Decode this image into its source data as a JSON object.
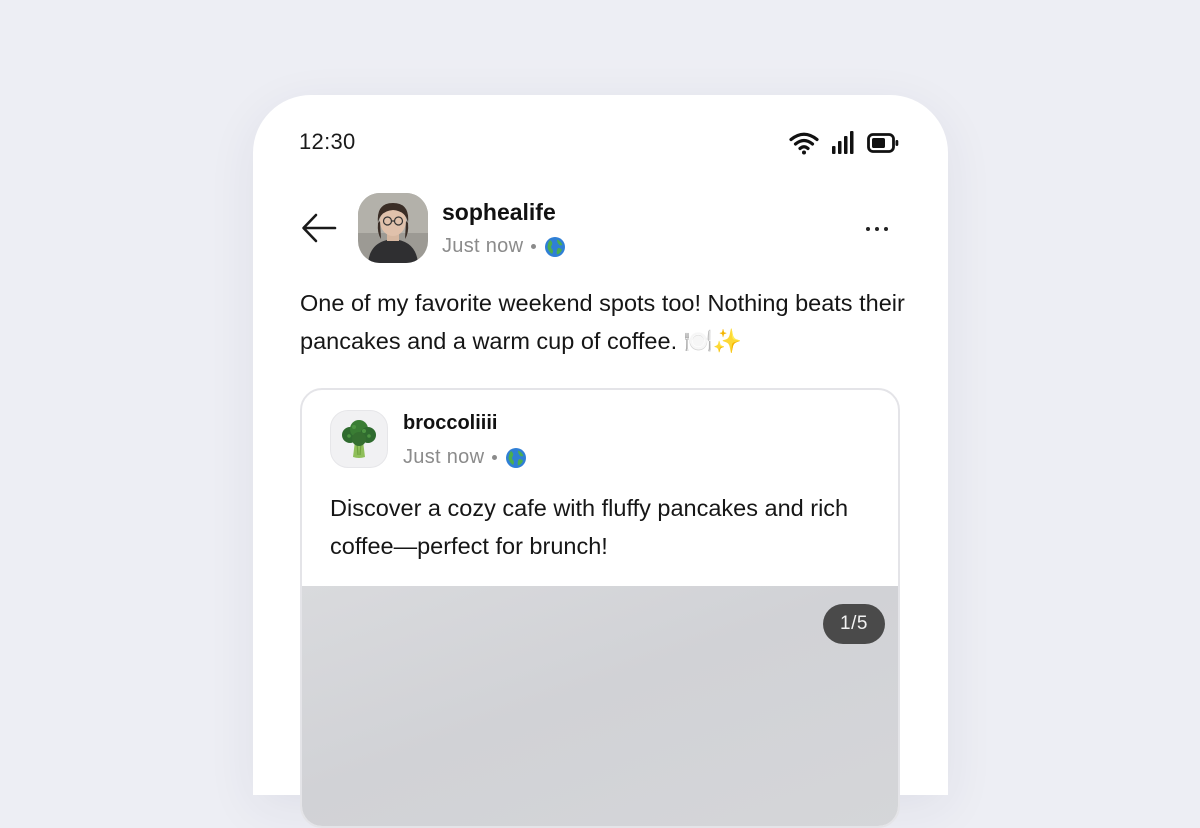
{
  "status_bar": {
    "time": "12:30",
    "icons": [
      "wifi-icon",
      "signal-icon",
      "battery-icon"
    ]
  },
  "header": {
    "back_icon": "arrow-left-icon",
    "author": "sophealife",
    "timestamp": "Just now",
    "visibility_icon": "globe-icon",
    "more_icon": "more-horizontal-icon"
  },
  "post": {
    "text": "One of my favorite weekend spots too! Nothing beats their pancakes and a warm cup of coffee. 🍽️✨"
  },
  "quoted_post": {
    "author": "broccoliiii",
    "avatar_icon": "broccoli-icon",
    "timestamp": "Just now",
    "visibility_icon": "globe-icon",
    "text": "Discover a cozy cafe with fluffy pancakes and rich coffee—perfect for brunch!",
    "image_counter": "1/5"
  },
  "colors": {
    "background": "#edeef4",
    "card": "#ffffff",
    "muted_text": "#8b8b8b",
    "counter_bg": "#4a4a4a"
  }
}
